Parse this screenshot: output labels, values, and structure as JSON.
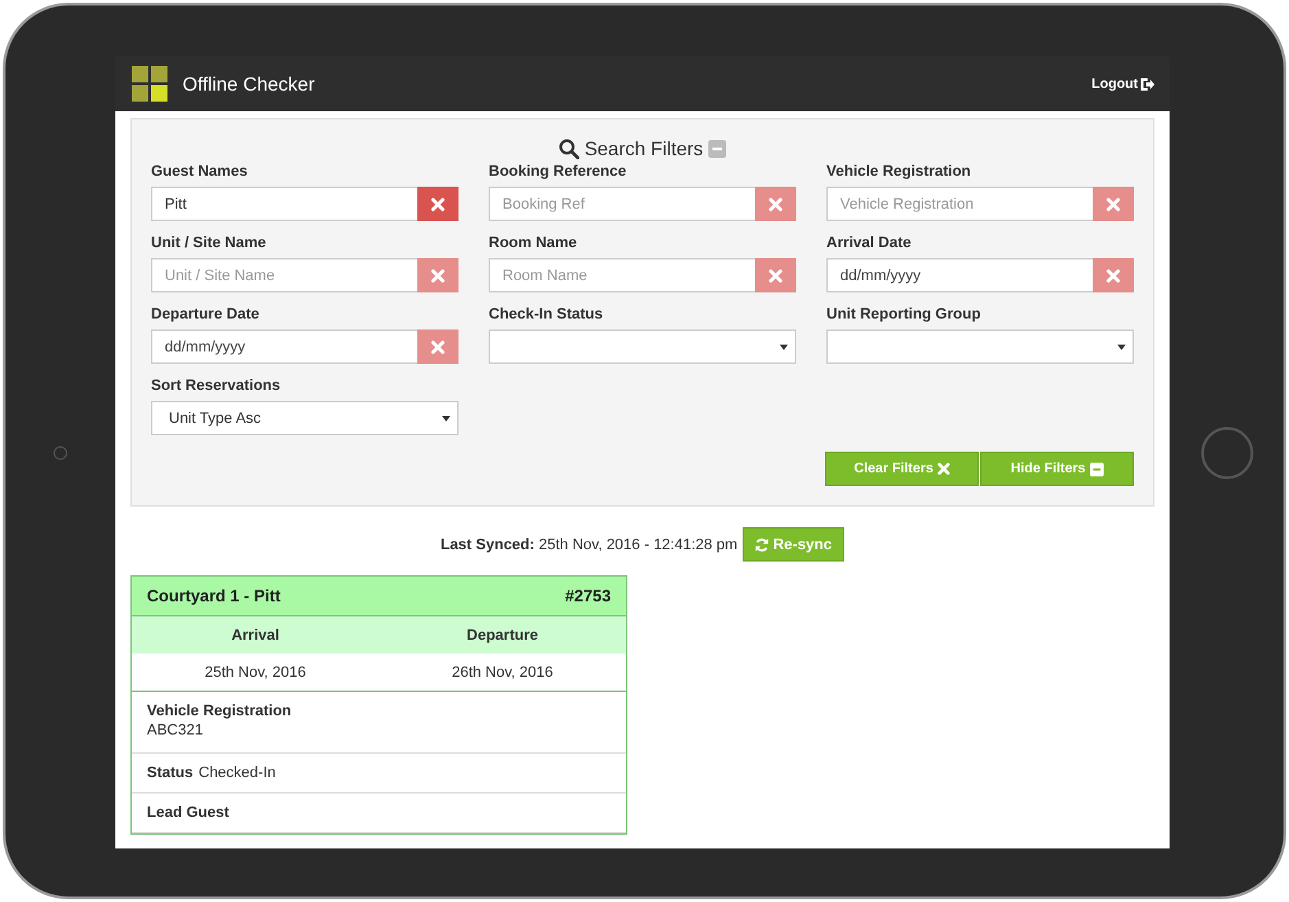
{
  "app": {
    "title": "Offline Checker",
    "logout": "Logout"
  },
  "filters": {
    "title": "Search Filters",
    "fields": [
      {
        "label": "Guest Names",
        "kind": "text",
        "value": "Pitt"
      },
      {
        "label": "Booking Reference",
        "kind": "text",
        "placeholder": "Booking Ref"
      },
      {
        "label": "Vehicle Registration",
        "kind": "text",
        "placeholder": "Vehicle Registration"
      },
      {
        "label": "Unit / Site Name",
        "kind": "text",
        "placeholder": "Unit / Site Name"
      },
      {
        "label": "Room Name",
        "kind": "text",
        "placeholder": "Room Name"
      },
      {
        "label": "Arrival Date",
        "kind": "date",
        "placeholder": "dd/mm/yyyy"
      },
      {
        "label": "Departure Date",
        "kind": "date",
        "placeholder": "dd/mm/yyyy"
      },
      {
        "label": "Check-In Status",
        "kind": "select"
      },
      {
        "label": "Unit Reporting Group",
        "kind": "select"
      },
      {
        "label": "Sort Reservations",
        "kind": "select",
        "value": "Unit Type Asc"
      }
    ],
    "buttons": [
      {
        "label": "Clear Filters",
        "kind": "clear"
      },
      {
        "label": "Hide Filters",
        "kind": "hide"
      }
    ]
  },
  "sync": {
    "label": "Last Synced:",
    "value": "25th Nov, 2016 - 12:41:28 pm",
    "button": "Re-sync"
  },
  "reservation": {
    "title": "Courtyard 1 - Pitt",
    "number": "#2753",
    "columns": [
      "Arrival",
      "Departure"
    ],
    "dates": [
      "25th Nov, 2016",
      "26th Nov, 2016"
    ],
    "vehicle_label": "Vehicle Registration",
    "vehicle": "ABC321",
    "status_label": "Status",
    "status": "Checked-In",
    "lead_guest_label": "Lead Guest"
  }
}
